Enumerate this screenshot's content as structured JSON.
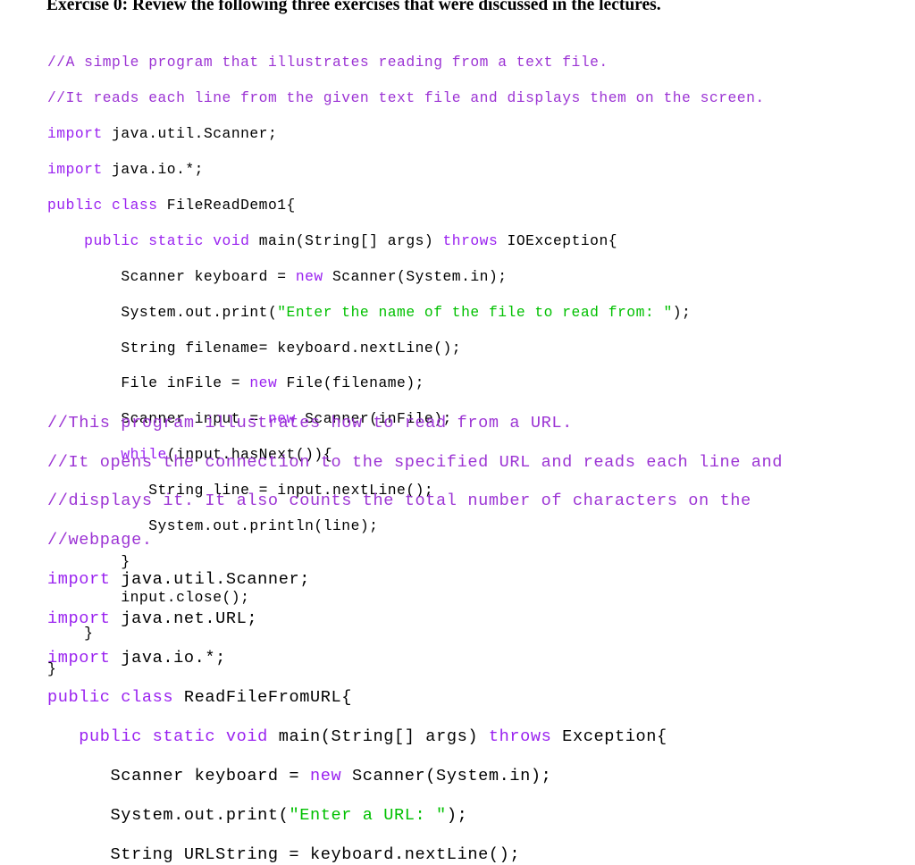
{
  "page": {
    "background_color": "#ffffff",
    "heading": "Exercise 0: Review the following three exercises that were discussed in the lectures."
  },
  "colors": {
    "comment": "#9C34D4",
    "keyword": "#9A22F0",
    "string": "#00C000",
    "plain": "#000000",
    "heading": "#000000",
    "background": "#ffffff"
  },
  "code_blocks": [
    {
      "id": "file-read-demo",
      "language": "java",
      "lines": [
        [
          {
            "t": "comment",
            "s": "//A simple program that illustrates reading from a text file."
          }
        ],
        [
          {
            "t": "comment",
            "s": "//It reads each line from the given text file and displays them on the screen."
          }
        ],
        [
          {
            "t": "keyword",
            "s": "import"
          },
          {
            "t": "plain",
            "s": " java.util.Scanner;"
          }
        ],
        [
          {
            "t": "keyword",
            "s": "import"
          },
          {
            "t": "plain",
            "s": " java.io.*;"
          }
        ],
        [
          {
            "t": "keyword",
            "s": "public class"
          },
          {
            "t": "plain",
            "s": " FileReadDemo1{"
          }
        ],
        [
          {
            "t": "plain",
            "s": "    "
          },
          {
            "t": "keyword",
            "s": "public static void"
          },
          {
            "t": "plain",
            "s": " main(String[] args) "
          },
          {
            "t": "keyword",
            "s": "throws"
          },
          {
            "t": "plain",
            "s": " IOException{"
          }
        ],
        [
          {
            "t": "plain",
            "s": "        Scanner keyboard = "
          },
          {
            "t": "keyword",
            "s": "new"
          },
          {
            "t": "plain",
            "s": " Scanner(System.in);"
          }
        ],
        [
          {
            "t": "plain",
            "s": "        System.out.print("
          },
          {
            "t": "string",
            "s": "\"Enter the name of the file to read from: \""
          },
          {
            "t": "plain",
            "s": ");"
          }
        ],
        [
          {
            "t": "plain",
            "s": "        String filename= keyboard.nextLine();"
          }
        ],
        [
          {
            "t": "plain",
            "s": "        File inFile = "
          },
          {
            "t": "keyword",
            "s": "new"
          },
          {
            "t": "plain",
            "s": " File(filename);"
          }
        ],
        [
          {
            "t": "plain",
            "s": "        Scanner input = "
          },
          {
            "t": "keyword",
            "s": "new"
          },
          {
            "t": "plain",
            "s": " Scanner(inFile);"
          }
        ],
        [
          {
            "t": "plain",
            "s": "        "
          },
          {
            "t": "keyword",
            "s": "while"
          },
          {
            "t": "plain",
            "s": "(input.hasNext()){"
          }
        ],
        [
          {
            "t": "plain",
            "s": "           String line = input.nextLine();"
          }
        ],
        [
          {
            "t": "plain",
            "s": "           System.out.println(line);"
          }
        ],
        [
          {
            "t": "plain",
            "s": "        }"
          }
        ],
        [
          {
            "t": "plain",
            "s": "        input.close();"
          }
        ],
        [
          {
            "t": "plain",
            "s": "    }"
          }
        ],
        [
          {
            "t": "plain",
            "s": "}"
          }
        ]
      ]
    },
    {
      "id": "read-file-from-url",
      "language": "java",
      "lines": [
        [
          {
            "t": "comment",
            "s": "//This program illustrates how to read from a URL."
          }
        ],
        [
          {
            "t": "comment",
            "s": "//It opens the connection to the specified URL and reads each line and"
          }
        ],
        [
          {
            "t": "comment",
            "s": "//displays it. It also counts the total number of characters on the"
          }
        ],
        [
          {
            "t": "comment",
            "s": "//webpage."
          }
        ],
        [
          {
            "t": "keyword",
            "s": "import"
          },
          {
            "t": "plain",
            "s": " java.util.Scanner;"
          }
        ],
        [
          {
            "t": "keyword",
            "s": "import"
          },
          {
            "t": "plain",
            "s": " java.net.URL;"
          }
        ],
        [
          {
            "t": "keyword",
            "s": "import"
          },
          {
            "t": "plain",
            "s": " java.io.*;"
          }
        ],
        [
          {
            "t": "keyword",
            "s": "public class"
          },
          {
            "t": "plain",
            "s": " ReadFileFromURL{"
          }
        ],
        [
          {
            "t": "plain",
            "s": "   "
          },
          {
            "t": "keyword",
            "s": "public static void"
          },
          {
            "t": "plain",
            "s": " main(String[] args) "
          },
          {
            "t": "keyword",
            "s": "throws"
          },
          {
            "t": "plain",
            "s": " Exception{"
          }
        ],
        [
          {
            "t": "plain",
            "s": "      Scanner keyboard = "
          },
          {
            "t": "keyword",
            "s": "new"
          },
          {
            "t": "plain",
            "s": " Scanner(System.in);"
          }
        ],
        [
          {
            "t": "plain",
            "s": "      System.out.print("
          },
          {
            "t": "string",
            "s": "\"Enter a URL: \""
          },
          {
            "t": "plain",
            "s": ");"
          }
        ],
        [
          {
            "t": "plain",
            "s": "      String URLString = keyboard.nextLine();"
          }
        ]
      ]
    }
  ]
}
